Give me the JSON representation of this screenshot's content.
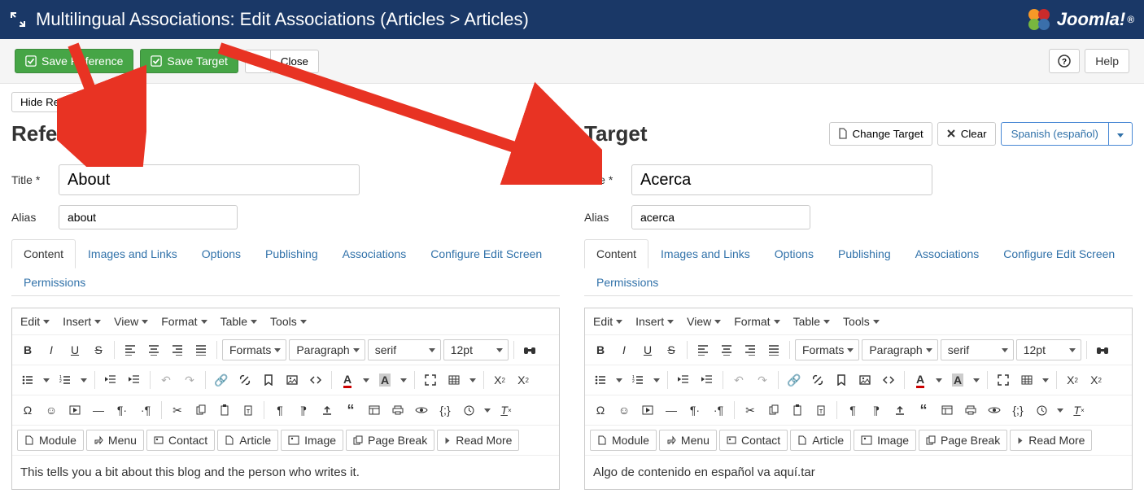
{
  "header": {
    "title": "Multilingual Associations: Edit Associations (Articles > Articles)",
    "brand": "Joomla!"
  },
  "toolbar": {
    "save_reference": "Save Reference",
    "save_target": "Save Target",
    "close": "Close",
    "help": "Help"
  },
  "hide_reference": "Hide Reference",
  "reference": {
    "heading": "Reference",
    "title_label": "Title *",
    "title_value": "About",
    "alias_label": "Alias",
    "alias_value": "about",
    "body": "This tells you a bit about this blog and the person who writes it."
  },
  "target": {
    "heading": "Target",
    "change_target": "Change Target",
    "clear": "Clear",
    "language": "Spanish (español)",
    "title_label": "Title *",
    "title_value": "Acerca",
    "alias_label": "Alias",
    "alias_value": "acerca",
    "body": "Algo de contenido en español va aquí.tar"
  },
  "tabs": [
    "Content",
    "Images and Links",
    "Options",
    "Publishing",
    "Associations",
    "Configure Edit Screen",
    "Permissions"
  ],
  "editor_menu": [
    "Edit",
    "Insert",
    "View",
    "Format",
    "Table",
    "Tools"
  ],
  "editor_selects": {
    "formats": "Formats",
    "paragraph": "Paragraph",
    "font": "serif",
    "size": "12pt"
  },
  "editor_longbtns": {
    "module": "Module",
    "menu": "Menu",
    "contact": "Contact",
    "article": "Article",
    "image": "Image",
    "pagebreak": "Page Break",
    "readmore": "Read More"
  }
}
